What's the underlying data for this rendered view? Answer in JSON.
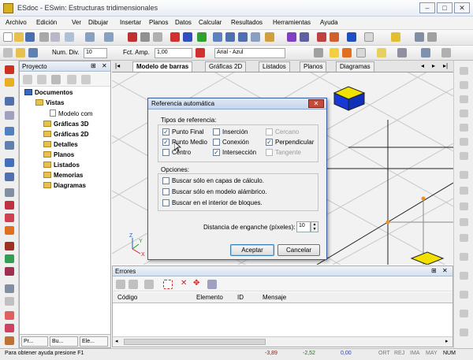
{
  "window": {
    "title": "ESdoc - ESwin: Estructuras tridimensionales",
    "controls": [
      "–",
      "□",
      "✕"
    ]
  },
  "menu": [
    "Archivo",
    "Edición",
    "Ver",
    "Dibujar",
    "Insertar",
    "Planos",
    "Datos",
    "Calcular",
    "Resultados",
    "Herramientas",
    "Ayuda"
  ],
  "toolbar2": {
    "num_div_label": "Num. Div.",
    "num_div_value": "10",
    "fct_amp_label": "Fct. Amp.",
    "fct_amp_value": "1,00",
    "font_value": "Arial - Azul"
  },
  "project": {
    "title": "Proyecto",
    "tree": {
      "root": "Documentos",
      "vistas": "Vistas",
      "modelo": "Modelo com",
      "items": [
        "Gráficas 3D",
        "Gráficas 2D",
        "Detalles",
        "Planos",
        "Listados",
        "Memorias",
        "Diagramas"
      ]
    },
    "tabs": [
      "Pr...",
      "Bu...",
      "Ele..."
    ]
  },
  "doc_tabs": [
    "Modelo de barras",
    "Gráficas 2D",
    "Listados",
    "Planos",
    "Diagramas"
  ],
  "dialog": {
    "title": "Referencia automática",
    "close": "✕",
    "tipos_label": "Tipos de referencia:",
    "refs": [
      {
        "label": "Punto Final",
        "checked": true,
        "enabled": true
      },
      {
        "label": "Inserción",
        "checked": false,
        "enabled": true
      },
      {
        "label": "Cercano",
        "checked": false,
        "enabled": false
      },
      {
        "label": "Punto Medio",
        "checked": true,
        "enabled": true
      },
      {
        "label": "Conexión",
        "checked": false,
        "enabled": true
      },
      {
        "label": "Perpendicular",
        "checked": true,
        "enabled": true
      },
      {
        "label": "Centro",
        "checked": false,
        "enabled": true
      },
      {
        "label": "Intersección",
        "checked": true,
        "enabled": true
      },
      {
        "label": "Tangente",
        "checked": false,
        "enabled": false
      }
    ],
    "opciones_label": "Opciones:",
    "opciones": [
      {
        "label": "Buscar sólo en capas de cálculo.",
        "checked": false
      },
      {
        "label": "Buscar sólo en modelo alámbrico.",
        "checked": false
      },
      {
        "label": "Buscar en el interior de bloques.",
        "checked": false
      }
    ],
    "distance_label": "Distancia de enganche (píxeles):",
    "distance_value": "10",
    "accept": "Aceptar",
    "cancel": "Cancelar"
  },
  "errors": {
    "title": "Errores",
    "columns": [
      "Código",
      "Elemento",
      "ID",
      "Mensaje"
    ]
  },
  "axes": {
    "z": "Z",
    "y": "Y",
    "x": "X"
  },
  "status": {
    "help": "Para obtener ayuda presione F1",
    "x": "-3,89",
    "y": "-2,52",
    "z": "0,00",
    "flags": [
      "ORT",
      "REJ",
      "IMA",
      "MAY",
      "NUM"
    ]
  },
  "colors": {
    "accent_blue": "#3a5fa0",
    "box_blue": "#1838d8",
    "box_yellow": "#f2e000",
    "node_orange": "#f09020",
    "coord_red": "#cc0000",
    "coord_green": "#008800"
  }
}
